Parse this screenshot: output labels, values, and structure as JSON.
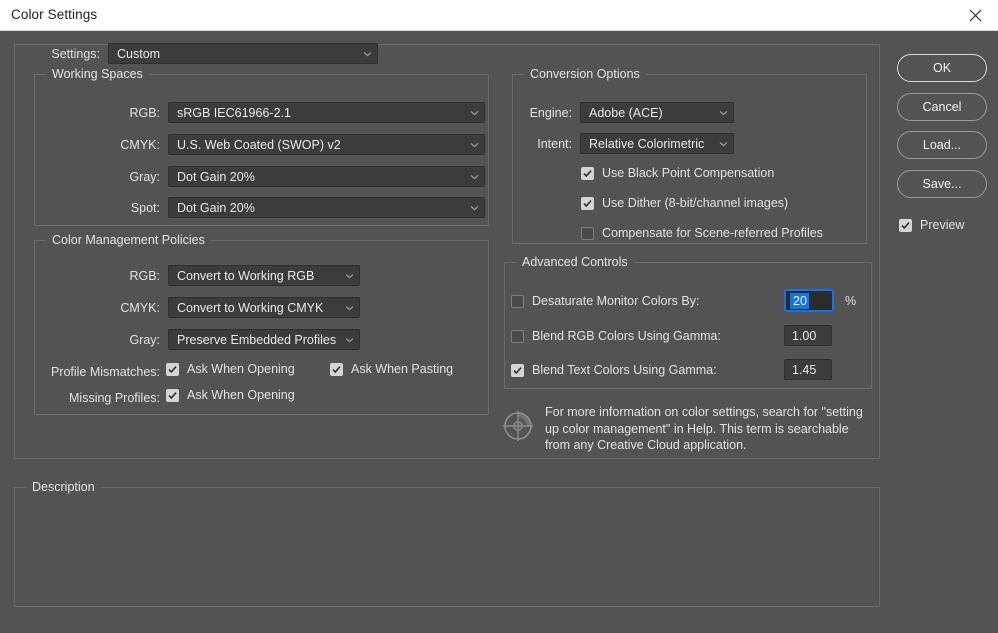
{
  "window": {
    "title": "Color Settings",
    "close_icon": "close-icon"
  },
  "settings_row": {
    "label": "Settings:",
    "value": "Custom"
  },
  "working_spaces": {
    "title": "Working Spaces",
    "rows": [
      {
        "label": "RGB:",
        "value": "sRGB IEC61966-2.1"
      },
      {
        "label": "CMYK:",
        "value": "U.S. Web Coated (SWOP) v2"
      },
      {
        "label": "Gray:",
        "value": "Dot Gain 20%"
      },
      {
        "label": "Spot:",
        "value": "Dot Gain 20%"
      }
    ]
  },
  "color_management_policies": {
    "title": "Color Management Policies",
    "rows": [
      {
        "label": "RGB:",
        "value": "Convert to Working RGB"
      },
      {
        "label": "CMYK:",
        "value": "Convert to Working CMYK"
      },
      {
        "label": "Gray:",
        "value": "Preserve Embedded Profiles"
      }
    ],
    "profile_mismatches_label": "Profile Mismatches:",
    "missing_profiles_label": "Missing Profiles:",
    "ask_when_opening_1": "Ask When Opening",
    "ask_when_pasting": "Ask When Pasting",
    "ask_when_opening_2": "Ask When Opening",
    "ask_when_opening_1_checked": true,
    "ask_when_pasting_checked": true,
    "ask_when_opening_2_checked": true
  },
  "conversion_options": {
    "title": "Conversion Options",
    "engine_label": "Engine:",
    "engine_value": "Adobe (ACE)",
    "intent_label": "Intent:",
    "intent_value": "Relative Colorimetric",
    "checks": [
      {
        "label": "Use Black Point Compensation",
        "checked": true
      },
      {
        "label": "Use Dither (8-bit/channel images)",
        "checked": true
      },
      {
        "label": "Compensate for Scene-referred Profiles",
        "checked": false
      }
    ]
  },
  "advanced_controls": {
    "title": "Advanced Controls",
    "rows": [
      {
        "label": "Desaturate Monitor Colors By:",
        "checked": false,
        "value": "20",
        "suffix": "%",
        "focused": true
      },
      {
        "label": "Blend RGB Colors Using Gamma:",
        "checked": false,
        "value": "1.00",
        "suffix": "",
        "focused": false
      },
      {
        "label": "Blend Text Colors Using Gamma:",
        "checked": true,
        "value": "1.45",
        "suffix": "",
        "focused": false
      }
    ]
  },
  "info": {
    "icon": "color-target-icon",
    "text": "For more information on color settings, search for \"setting up color management\" in Help. This term is searchable from any Creative Cloud application."
  },
  "buttons": {
    "ok": "OK",
    "cancel": "Cancel",
    "load": "Load...",
    "save": "Save...",
    "preview_label": "Preview",
    "preview_checked": true
  },
  "description": {
    "title": "Description",
    "body": ""
  },
  "colors": {
    "background": "#535353",
    "field": "#3c3c3c",
    "accent": "#1473e6",
    "text": "#e2e2e2",
    "titlebar": "#ffffff"
  }
}
